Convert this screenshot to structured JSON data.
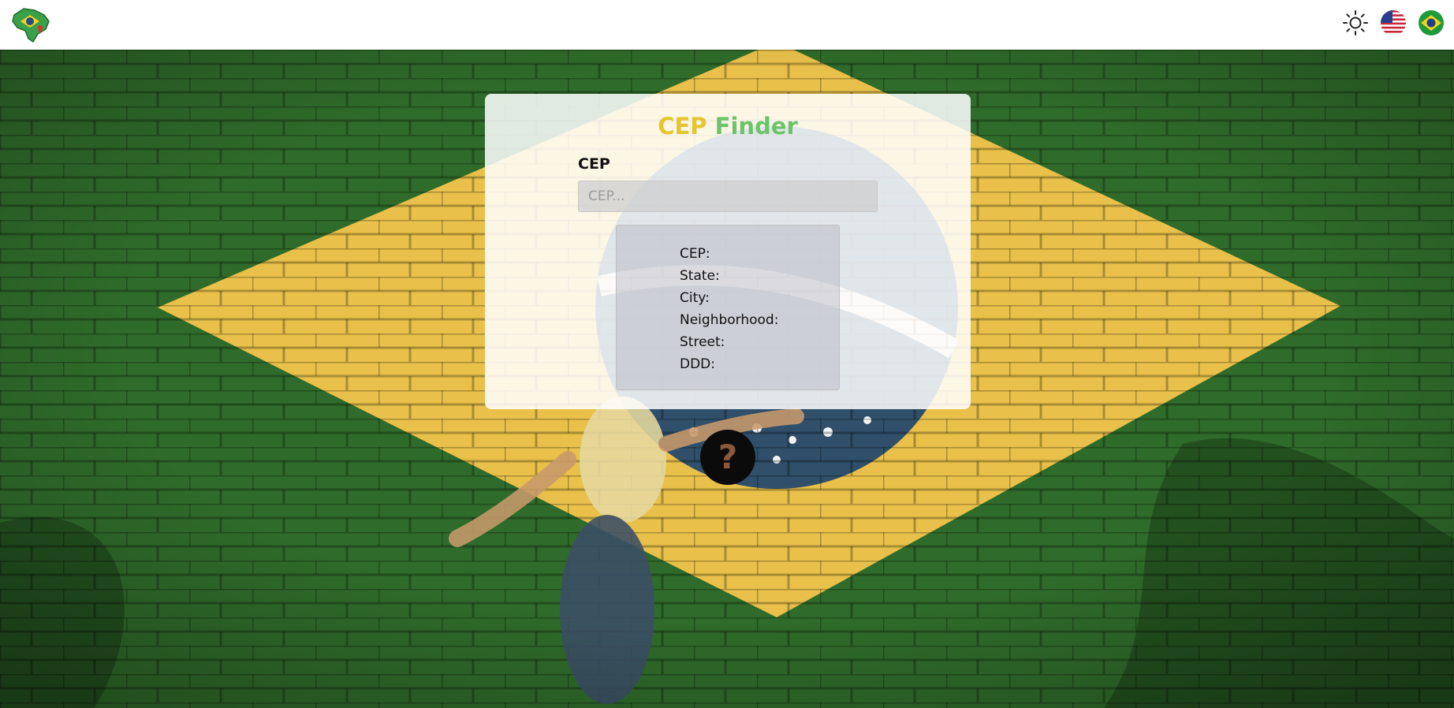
{
  "header": {
    "logo_icon": "brazil-map-logo",
    "theme_icon": "sun-icon",
    "lang_en_icon": "us-flag-icon",
    "lang_pt_icon": "brazil-flag-icon"
  },
  "card": {
    "title_part1": "CEP",
    "title_part2": "Finder",
    "title_color1": "#e5c530",
    "title_color2": "#6cc36a",
    "field_label": "CEP",
    "input_value": "",
    "input_placeholder": "CEP...",
    "results": [
      {
        "label": "CEP:"
      },
      {
        "label": "State:"
      },
      {
        "label": "City:"
      },
      {
        "label": "Neighborhood:"
      },
      {
        "label": "Street:"
      },
      {
        "label": "DDD:"
      }
    ]
  },
  "help": {
    "label": "?",
    "icon": "question-icon"
  },
  "colors": {
    "flag_green": "#2f6b2a",
    "flag_yellow": "#e8c04a",
    "flag_blue": "#2f4f6a"
  }
}
